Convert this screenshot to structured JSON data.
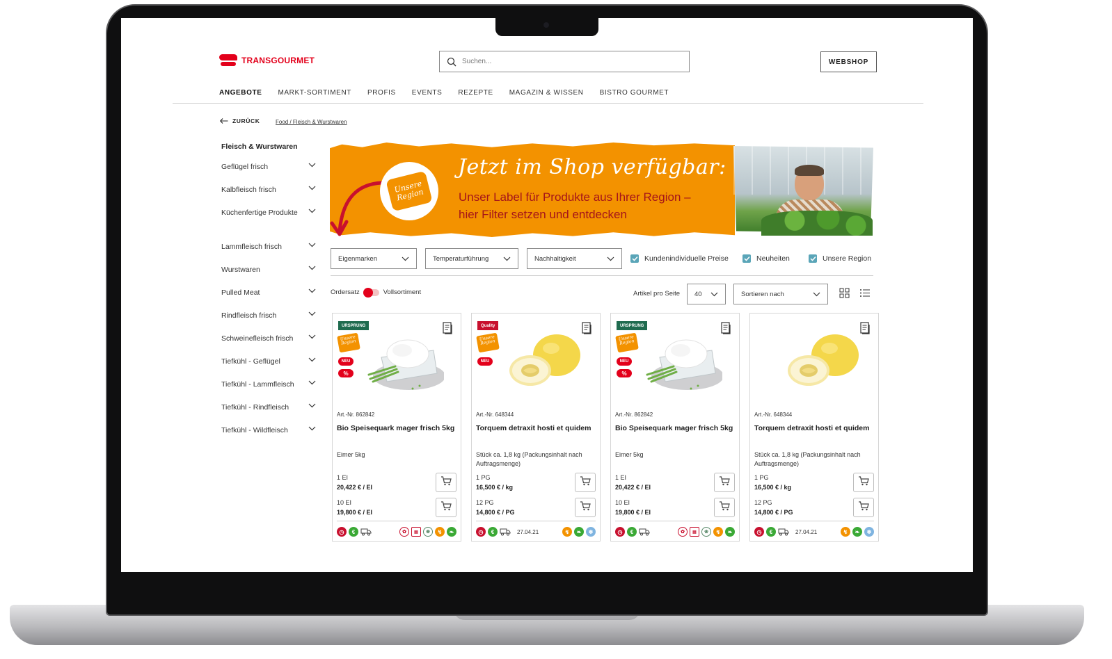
{
  "header": {
    "brand": "TRANSGOURMET",
    "search_placeholder": "Suchen...",
    "webshop_label": "WEBSHOP"
  },
  "nav": [
    {
      "label": "ANGEBOTE",
      "active": true
    },
    {
      "label": "MARKT-SORTIMENT",
      "active": false
    },
    {
      "label": "PROFIS",
      "active": false
    },
    {
      "label": "EVENTS",
      "active": false
    },
    {
      "label": "REZEPTE",
      "active": false
    },
    {
      "label": "MAGAZIN & WISSEN",
      "active": false
    },
    {
      "label": "BISTRO GOURMET",
      "active": false
    }
  ],
  "breadcrumb": {
    "back_label": "ZURÜCK",
    "path": "Food / Fleisch & Wurstwaren"
  },
  "sidebar": {
    "title": "Fleisch & Wurstwaren",
    "items": [
      "Geflügel frisch",
      "Kalbfleisch frisch",
      "Küchenfertige Produkte",
      "Lammfleisch frisch",
      "Wurstwaren",
      "Pulled Meat",
      "Rindfleisch frisch",
      "Schweinefleisch frisch",
      "Tiefkühl - Geflügel",
      "Tiefkühl - Lammfleisch",
      "Tiefkühl - Rindfleisch",
      "Tiefkühl - Wildfleisch"
    ]
  },
  "banner": {
    "badge": "Unsere Region",
    "title": "Jetzt im Shop verfügbar:",
    "subtitle_line1": "Unser Label für Produkte aus Ihrer Region –",
    "subtitle_line2": "hier Filter setzen und entdecken"
  },
  "filters": {
    "dropdowns": [
      "Eigenmarken",
      "Temperaturführung",
      "Nachhaltigkeit"
    ],
    "checkboxes": [
      {
        "label": "Kundenindividuelle Preise",
        "checked": true
      },
      {
        "label": "Neuheiten",
        "checked": true
      },
      {
        "label": "Unsere Region",
        "checked": true
      }
    ]
  },
  "toolbar": {
    "toggle_left": "Ordersatz",
    "toggle_right": "Vollsortiment",
    "per_page_label": "Artikel pro Seite",
    "per_page_value": "40",
    "sort_label": "Sortieren nach"
  },
  "products": [
    {
      "brand_tag": "URSPRUNG",
      "brand_color": "#1f6b4f",
      "region_badge": "Unsere Region",
      "neu_label": "NEU",
      "pct_label": "%",
      "artno": "Art.-Nr. 862842",
      "name": "Bio Speisequark mager frisch 5kg",
      "desc": "Eimer 5kg",
      "unit1": "1 EI",
      "price1": "20,422 € / EI",
      "unit2": "10 EI",
      "price2": "19,800 € / EI",
      "date": "",
      "image": "quark"
    },
    {
      "brand_tag": "Quality",
      "brand_color": "#c8102e",
      "region_badge": "Unsere Region",
      "neu_label": "NEU",
      "pct_label": "",
      "artno": "Art.-Nr. 648344",
      "name": "Torquem detraxit hosti et quidem",
      "desc": "Stück ca. 1,8 kg (Packungsinhalt nach Auftragsmenge)",
      "unit1": "1 PG",
      "price1": "16,500 € / kg",
      "unit2": "12 PG",
      "price2": "14,800 € / PG",
      "date": "27.04.21",
      "image": "melon"
    },
    {
      "brand_tag": "URSPRUNG",
      "brand_color": "#1f6b4f",
      "region_badge": "Unsere Region",
      "neu_label": "NEU",
      "pct_label": "%",
      "artno": "Art.-Nr. 862842",
      "name": "Bio Speisequark mager frisch 5kg",
      "desc": "Eimer 5kg",
      "unit1": "1 EI",
      "price1": "20,422 € / EI",
      "unit2": "10 EI",
      "price2": "19,800 € / EI",
      "date": "",
      "image": "quark"
    },
    {
      "brand_tag": "",
      "brand_color": "",
      "region_badge": "",
      "neu_label": "",
      "pct_label": "",
      "artno": "Art.-Nr. 648344",
      "name": "Torquem detraxit hosti et quidem",
      "desc": "Stück ca. 1,8 kg (Packungsinhalt nach Auftragsmenge)",
      "unit1": "1 PG",
      "price1": "16,500 € / kg",
      "unit2": "12 PG",
      "price2": "14,800 € / PG",
      "date": "27.04.21",
      "image": "melon"
    }
  ],
  "colors": {
    "brand_red": "#e3001b",
    "region_orange": "#f39200",
    "checkbox_teal": "#5aa5b8"
  }
}
